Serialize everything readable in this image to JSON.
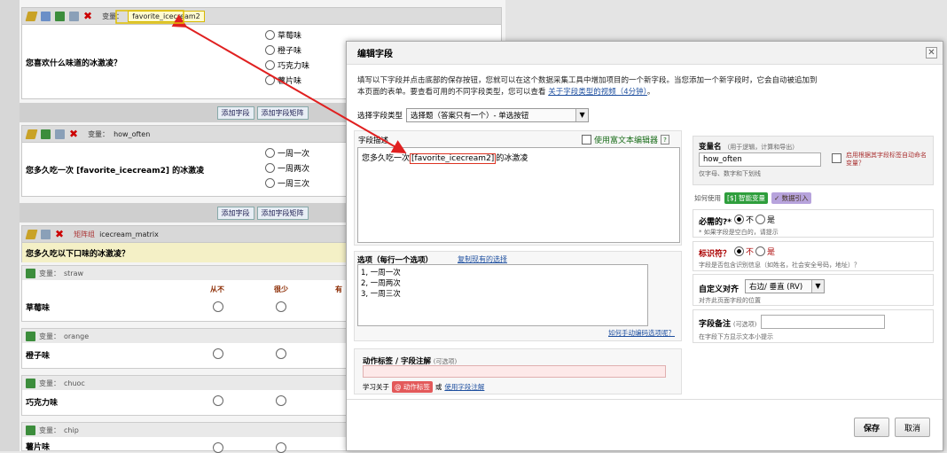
{
  "bg": {
    "field1": {
      "var_label": "变量：",
      "var_name": "favorite_icecream2",
      "question": "您喜欢什么味道的冰激凌？",
      "options": [
        "草莓味",
        "橙子味",
        "巧克力味",
        "薯片味"
      ]
    },
    "add_field": "添加字段",
    "add_matrix": "添加字段矩阵",
    "field2": {
      "var_label": "变量：",
      "var_name": "how_often",
      "question": "您多久吃一次 [favorite_icecream2] 的冰激凌",
      "options": [
        "一周一次",
        "一周两次",
        "一周三次"
      ]
    },
    "matrix": {
      "label": "矩阵组",
      "name": "icecream_matrix",
      "question": "您多久吃以下口味的冰激凌？",
      "columns": [
        "从不",
        "很少",
        "有"
      ],
      "rows": [
        {
          "var_label": "变量：",
          "var": "straw",
          "label": "草莓味"
        },
        {
          "var_label": "变量：",
          "var": "orange",
          "label": "橙子味"
        },
        {
          "var_label": "变量：",
          "var": "chuoc",
          "label": "巧克力味"
        },
        {
          "var_label": "变量：",
          "var": "chip",
          "label": "薯片味"
        }
      ]
    }
  },
  "dialog": {
    "title": "编辑字段",
    "close": "✕",
    "instructions_1": "填写以下字段并点击底部的保存按钮，您就可以在这个数据采集工具中增加项目的一个新字段。当您添加一个新字段时，它会自动被追加到",
    "instructions_2": "本页面的表单。要查看可用的不同字段类型，您可以查看 ",
    "instructions_link": "关于字段类型的视频（4分钟）",
    "instructions_end": "。",
    "field_type_label": "选择字段类型",
    "field_type_value": "选择题（答案只有一个）- 单选按钮",
    "field_label_title": "字段描述",
    "rich_text_label": "使用富文本编辑器",
    "help_q": "?",
    "field_label_prefix": "您多久吃一次",
    "field_label_piped": "[favorite_icecream2]",
    "field_label_suffix": "的冰激凌",
    "choices_title": "选项（每行一个选项）",
    "copy_choices": "复制现有的选择",
    "choices": [
      "1, 一周一次",
      "2, 一周两次",
      "3, 一周三次"
    ],
    "manual_codes": "如何手动编码选项呢？",
    "action_tags_title": "动作标签 / 字段注解",
    "optional": "(可选项)",
    "learn_about": "学习关于",
    "action_tags_badge": "@ 动作标签",
    "or": "或",
    "field_annotation_link": "使用字段注解",
    "var_name_title": "变量名",
    "var_name_hint": "（用于逻辑，计算和导出）",
    "var_name_value": "how_often",
    "var_name_rule": "仅字母、数字和下划线",
    "auto_name": "启用根据其字段标签自动命名变量？",
    "how_to_use": "如何使用",
    "smart_vars": "[$] 智能变量",
    "piping": "✓ 数据引入",
    "required_title": "必需的?*",
    "required_no": "不",
    "required_yes": "是",
    "required_hint": "* 如果字段是空白的，请提示",
    "identifier_title": "标识符？",
    "identifier_no": "不",
    "identifier_yes": "是",
    "identifier_hint": "字段是否包含识别信息（如姓名，社会安全号码，地址）？",
    "align_title": "自定义对齐",
    "align_value": "右边/ 垂直 (RV)",
    "align_hint": "对齐此页面字段的位置",
    "note_title": "字段备注",
    "note_hint": "在字段下方显示文本小提示",
    "save": "保存",
    "cancel": "取消"
  }
}
